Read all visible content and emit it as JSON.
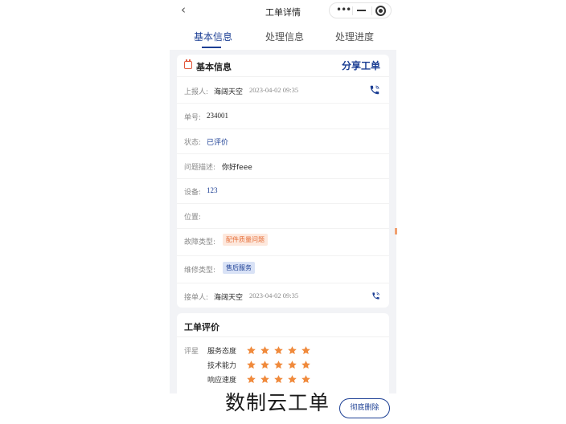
{
  "nav": {
    "back_glyph": "‹",
    "title": "工单详情"
  },
  "tabs": [
    {
      "label": "基本信息",
      "active": true
    },
    {
      "label": "处理信息",
      "active": false
    },
    {
      "label": "处理进度",
      "active": false
    }
  ],
  "basic": {
    "title": "基本信息",
    "share": "分享工单",
    "reporter": {
      "label": "上报人:",
      "name": "海阔天空",
      "time": "2023-04-02 09:35"
    },
    "order_no": {
      "label": "单号:",
      "value": "234001"
    },
    "status": {
      "label": "状态:",
      "value": "已评价"
    },
    "problem": {
      "label": "问题描述:",
      "value": "你好feee"
    },
    "device": {
      "label": "设备:",
      "value": "123"
    },
    "location": {
      "label": "位置:",
      "value": ""
    },
    "fault_type": {
      "label": "故障类型:",
      "value": "配件质量问题"
    },
    "repair_type": {
      "label": "维修类型:",
      "value": "售后服务"
    },
    "receiver": {
      "label": "接单人:",
      "name": "海阔天空",
      "time": "2023-04-02 09:35"
    }
  },
  "evaluation": {
    "title": "工单评价",
    "label": "评星",
    "items": [
      {
        "name": "服务态度",
        "stars": 5
      },
      {
        "name": "技术能力",
        "stars": 5
      },
      {
        "name": "响应速度",
        "stars": 5
      }
    ]
  },
  "bottom": {
    "delete_button": "彻底删除"
  },
  "watermark": "数制云工单",
  "colors": {
    "primary": "#1c3f94",
    "star": "#f08a3c",
    "tag_orange": "#e66f39",
    "accent_red": "#e2573b"
  },
  "icons": {
    "calendar": "calendar-icon",
    "phone": "phone-icon",
    "star": "star-icon",
    "more": "more-dots-icon",
    "minimize": "minimize-icon",
    "close": "close-target-icon"
  }
}
